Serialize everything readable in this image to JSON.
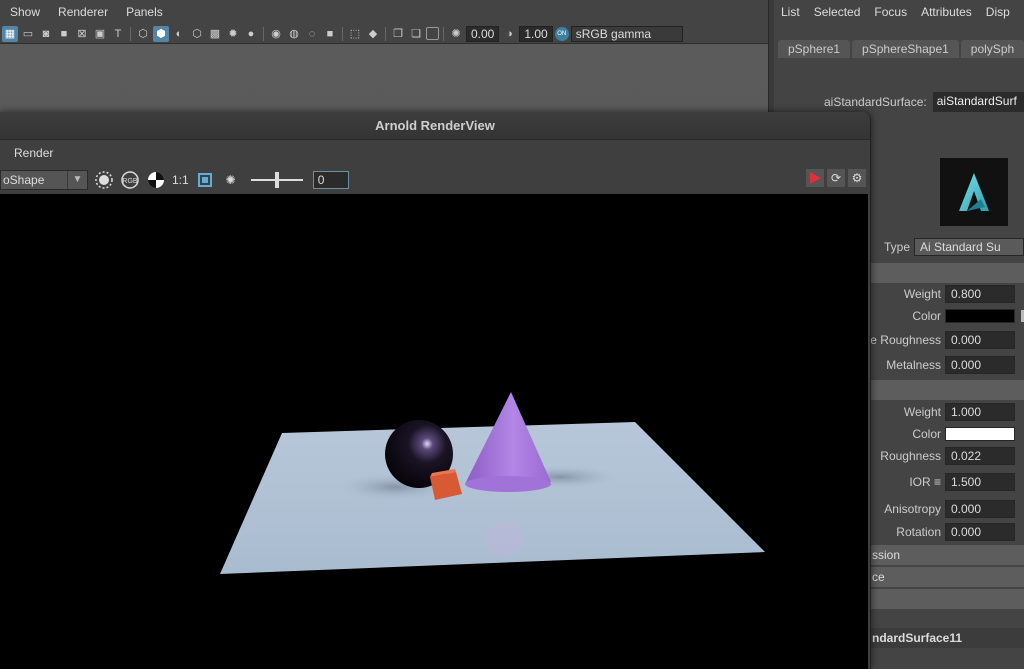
{
  "viewport": {
    "menu": [
      "Show",
      "Renderer",
      "Panels"
    ],
    "exposure_value": "0.00",
    "gamma_value": "1.00",
    "colorspace_toggle": "ON",
    "colorspace_label": "sRGB gamma"
  },
  "attribute_editor": {
    "menu": [
      "List",
      "Selected",
      "Focus",
      "Attributes",
      "Disp"
    ],
    "tabs": [
      "pSphere1",
      "pSphereShape1",
      "polySph"
    ],
    "node_type_label": "aiStandardSurface:",
    "node_name": "aiStandardSurf",
    "type_label": "Type",
    "type_value": "Ai Standard Su",
    "base": {
      "weight_label": "Weight",
      "weight_value": "0.800",
      "color_label": "Color",
      "color_hex": "#000000",
      "diffuse_roughness_label": "e Roughness",
      "diffuse_roughness_value": "0.000",
      "metalness_label": "Metalness",
      "metalness_value": "0.000"
    },
    "specular": {
      "weight_label": "Weight",
      "weight_value": "1.000",
      "color_label": "Color",
      "color_hex": "#ffffff",
      "roughness_label": "Roughness",
      "roughness_value": "0.022",
      "ior_label": "IOR ≡",
      "ior_value": "1.500",
      "anisotropy_label": "Anisotropy",
      "anisotropy_value": "0.000",
      "rotation_label": "Rotation",
      "rotation_value": "0.000"
    },
    "section_emission": "ssion",
    "section_next": "ce",
    "footer_name": "ndardSurface11"
  },
  "renderview": {
    "title": "Arnold RenderView",
    "menu_render": "Render",
    "camera_combo": "oShape",
    "ratio_label": "1:1",
    "frame_value": "0"
  },
  "colors": {
    "accent": "#5285a6",
    "render_button": "#d0303a",
    "floor": "#b3c3d6",
    "cone": "#a673d6",
    "cube": "#d85a35",
    "sphere": "#1a1420"
  }
}
